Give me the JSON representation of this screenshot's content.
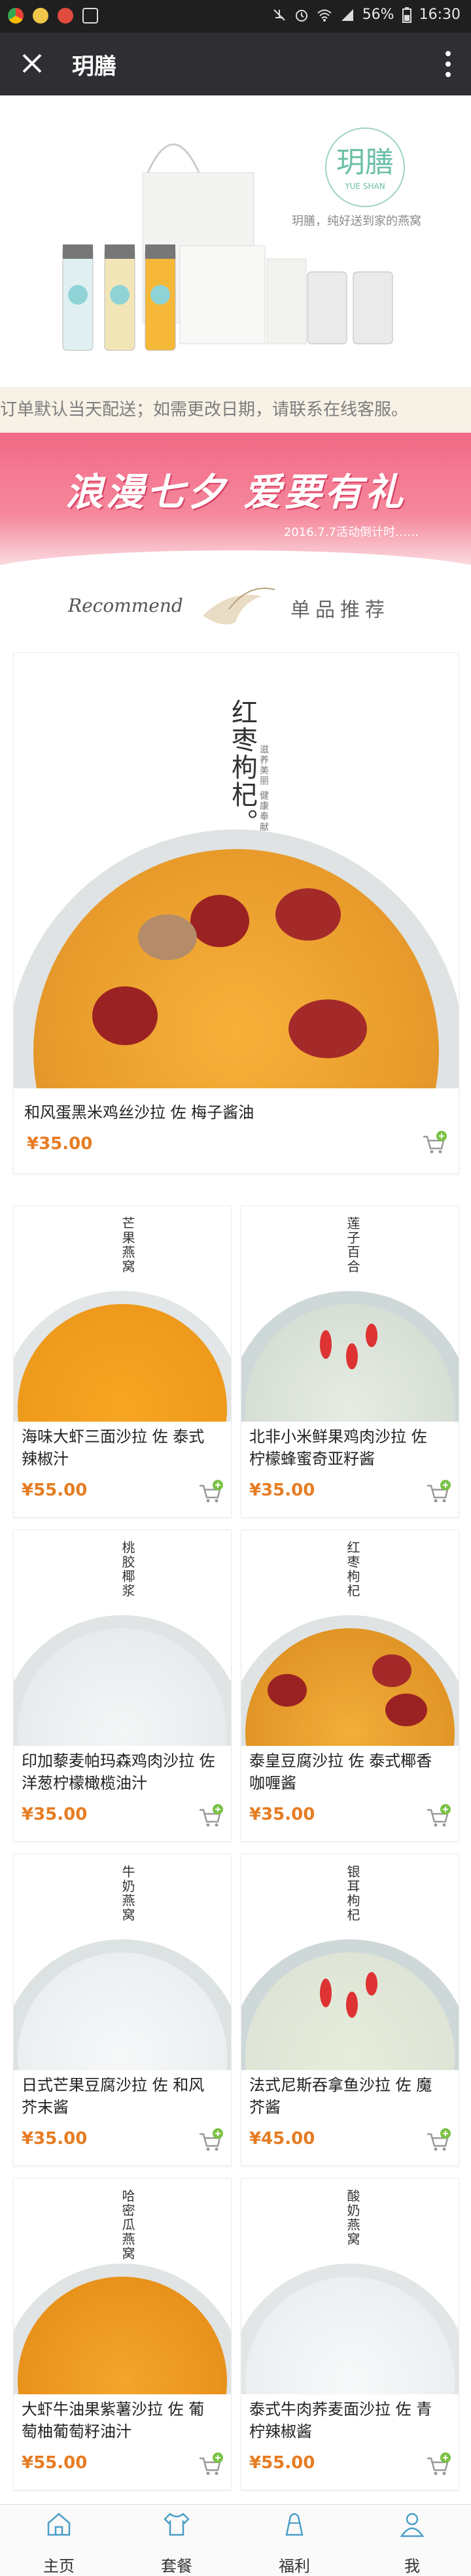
{
  "status": {
    "battery": "56%",
    "time": "16:30"
  },
  "header": {
    "title": "玥膳"
  },
  "banner": {
    "brand": "玥膳",
    "brand_en": "YUE SHAN",
    "slogan": "玥膳，纯好送到家的燕窝"
  },
  "notice": "订单默认当天配送；如需更改日期，请联系在线客服。",
  "promo": {
    "title": "浪漫七夕 爱要有礼",
    "subtitle": "2016.7.7活动倒计时……"
  },
  "recommend": {
    "en": "Recommend",
    "cn": "单品推荐"
  },
  "featured": {
    "vertical_title": "红枣枸杞。",
    "vertical_sub": "滋养美丽 健康奉献",
    "name": "和风蛋黑米鸡丝沙拉 佐 梅子酱油",
    "price": "¥35.00"
  },
  "products": [
    {
      "vtitle": "芒果燕窝",
      "name": "海味大虾三面沙拉 佐 泰式辣椒汁",
      "price": "¥55.00"
    },
    {
      "vtitle": "莲子百合",
      "name": "北非小米鲜果鸡肉沙拉 佐 柠檬蜂蜜奇亚籽酱",
      "price": "¥35.00"
    },
    {
      "vtitle": "桃胶椰浆",
      "name": "印加藜麦帕玛森鸡肉沙拉 佐 洋葱柠檬橄榄油汁",
      "price": "¥35.00"
    },
    {
      "vtitle": "红枣枸杞",
      "name": "泰皇豆腐沙拉 佐 泰式椰香咖喱酱",
      "price": "¥35.00"
    },
    {
      "vtitle": "牛奶燕窝",
      "name": "日式芒果豆腐沙拉 佐 和风芥末酱",
      "price": "¥35.00"
    },
    {
      "vtitle": "银耳枸杞",
      "name": "法式尼斯吞拿鱼沙拉 佐 魔芥酱",
      "price": "¥45.00"
    },
    {
      "vtitle": "哈密瓜燕窝",
      "name": "大虾牛油果紫薯沙拉 佐 葡萄柚葡萄籽油汁",
      "price": "¥55.00"
    },
    {
      "vtitle": "酸奶燕窝",
      "name": "泰式牛肉荞麦面沙拉 佐 青柠辣椒酱",
      "price": "¥55.00"
    }
  ],
  "tabs": [
    {
      "label": "主页",
      "icon": "home-icon"
    },
    {
      "label": "套餐",
      "icon": "shirt-icon"
    },
    {
      "label": "福利",
      "icon": "gift-bag-icon"
    },
    {
      "label": "我",
      "icon": "person-icon"
    }
  ],
  "colors": {
    "accent": "#e67c22",
    "cart": "#7ac143",
    "header": "#2e2e33",
    "promo": "#f26a86"
  }
}
